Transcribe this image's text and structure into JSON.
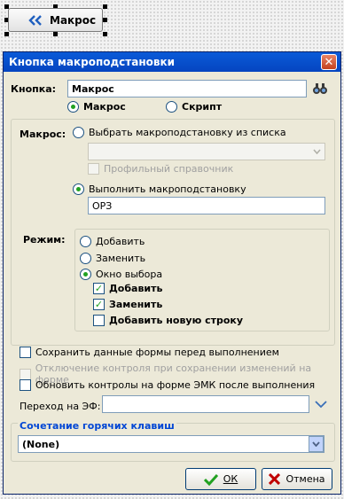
{
  "designer": {
    "button_label": "Макрос",
    "button_icon": "double-chevron-left-icon"
  },
  "dialog": {
    "title": "Кнопка макроподстановки",
    "button_field": {
      "label": "Кнопка:",
      "value": "Макрос",
      "icon": "binoculars-icon"
    },
    "type_options": [
      {
        "label": "Макрос",
        "selected": true
      },
      {
        "label": "Скрипт",
        "selected": false
      }
    ],
    "macro": {
      "label": "Макрос:",
      "choose_from_list": {
        "label": "Выбрать макроподстановку из списка",
        "selected": false
      },
      "profile_reference": {
        "label": "Профильный справочник",
        "checked": false,
        "enabled": false
      },
      "execute": {
        "label": "Выполнить макроподстановку",
        "selected": true,
        "value": "ОРЗ"
      }
    },
    "mode": {
      "label": "Режим:",
      "options": [
        {
          "label": "Добавить",
          "selected": false
        },
        {
          "label": "Заменить",
          "selected": false
        },
        {
          "label": "Окно выбора",
          "selected": true
        }
      ],
      "sub_options": [
        {
          "label": "Добавить",
          "checked": true
        },
        {
          "label": "Заменить",
          "checked": true
        },
        {
          "label": "Добавить новую строку",
          "checked": false
        }
      ]
    },
    "options": [
      {
        "label": "Сохранить данные формы перед выполнением",
        "checked": false,
        "enabled": true
      },
      {
        "label": "Отключение контроля при сохранении изменений на форме",
        "checked": false,
        "enabled": false
      },
      {
        "label": "Обновить контролы на форме ЭМК после выполнения",
        "checked": false,
        "enabled": true
      }
    ],
    "transition": {
      "label": "Переход на ЭФ:",
      "value": ""
    },
    "hotkeys": {
      "label": "Сочетание горячих клавиш",
      "value": "(None)"
    },
    "ok_button": "ОК",
    "cancel_button": "Отмена"
  },
  "colors": {
    "title_bar": "#0a5ad8",
    "accent_green": "#21a121",
    "group_title": "#0046d5",
    "cancel_red": "#c00000"
  }
}
